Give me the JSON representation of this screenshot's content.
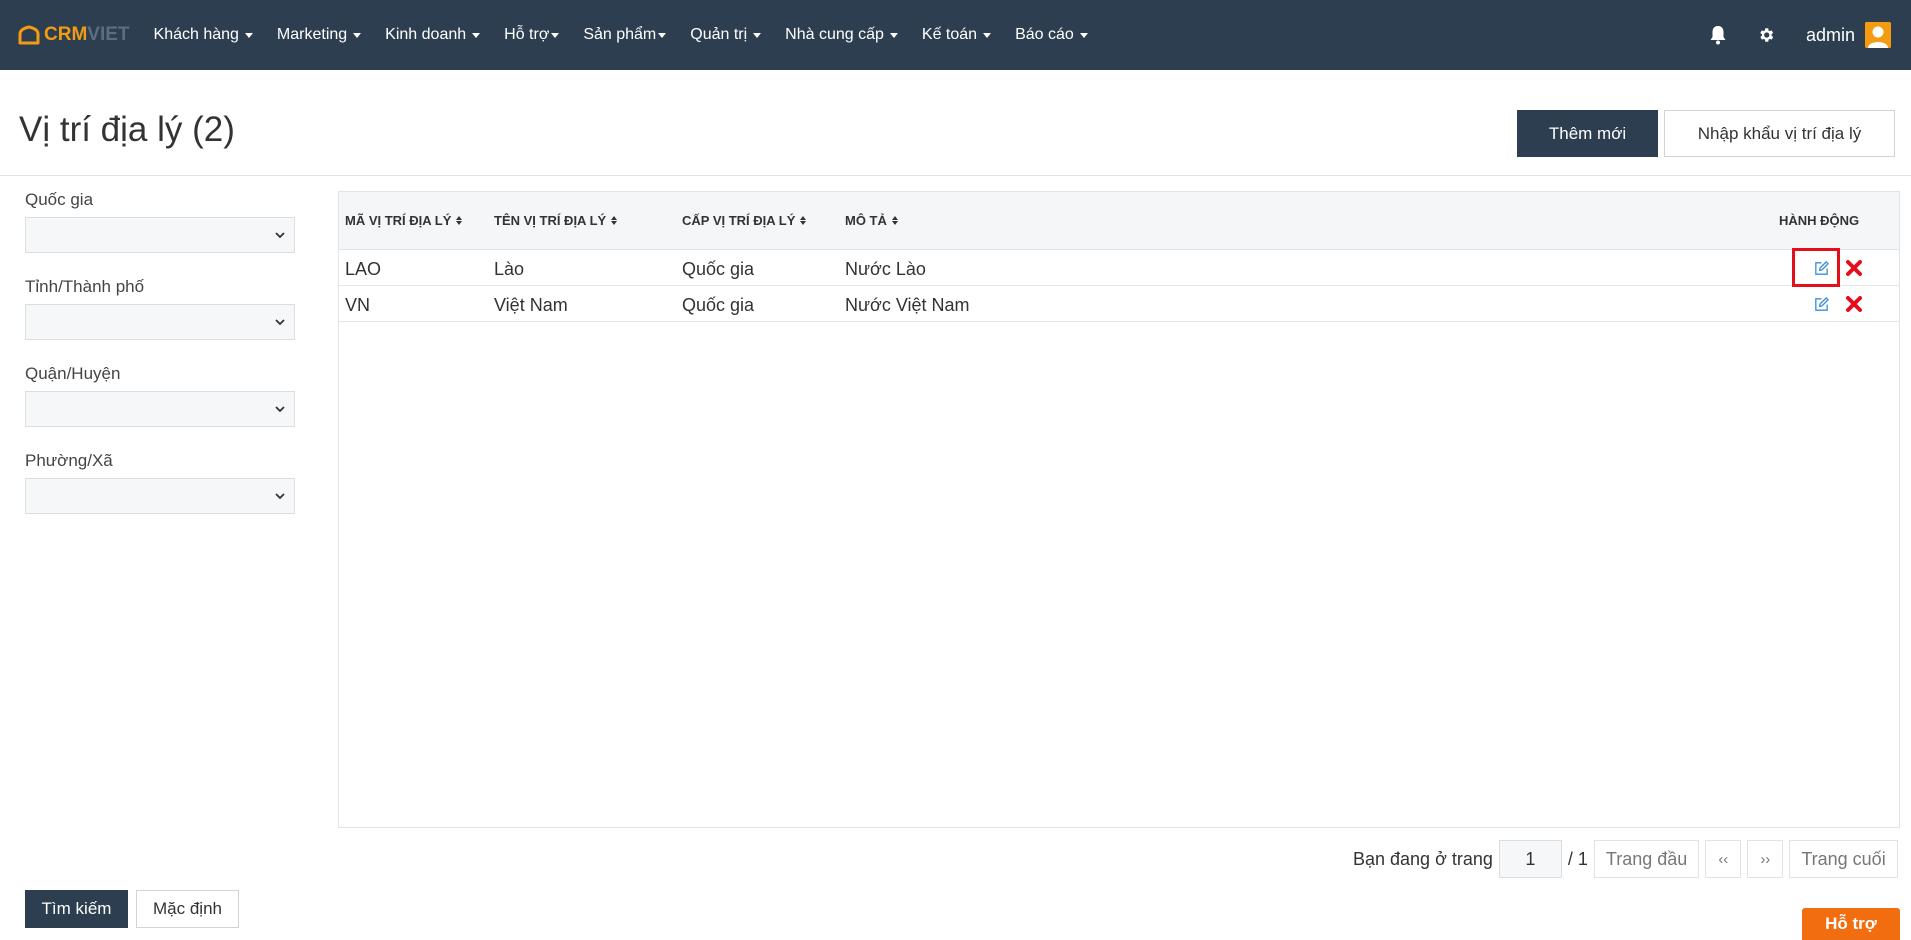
{
  "brand": {
    "crm": "CRM",
    "viet": "VIET"
  },
  "nav": {
    "items": [
      {
        "label": "Khách hàng"
      },
      {
        "label": "Marketing"
      },
      {
        "label": "Kinh doanh"
      },
      {
        "label": "Hỗ trợ"
      },
      {
        "label": "Sản phẩm"
      },
      {
        "label": "Quản trị"
      },
      {
        "label": "Nhà cung cấp"
      },
      {
        "label": "Kế toán"
      },
      {
        "label": "Báo cáo"
      }
    ],
    "user": "admin"
  },
  "page": {
    "title": "Vị trí địa lý (2)",
    "add_label": "Thêm mới",
    "import_label": "Nhập khẩu vị trí địa lý"
  },
  "filters": {
    "country_label": "Quốc gia",
    "province_label": "Tỉnh/Thành phố",
    "district_label": "Quận/Huyện",
    "ward_label": "Phường/Xã",
    "search_label": "Tìm kiếm",
    "default_label": "Mặc định"
  },
  "table": {
    "headers": {
      "code": "MÃ VỊ TRÍ ĐỊA LÝ",
      "name": "TÊN VỊ TRÍ ĐỊA LÝ",
      "level": "CẤP VỊ TRÍ ĐỊA LÝ",
      "desc": "MÔ TẢ",
      "action": "HÀNH ĐỘNG"
    },
    "rows": [
      {
        "code": "LAO",
        "name": "Lào",
        "level": "Quốc gia",
        "desc": "Nước Lào"
      },
      {
        "code": "VN",
        "name": "Việt Nam",
        "level": "Quốc gia",
        "desc": "Nước Việt Nam"
      }
    ]
  },
  "pagination": {
    "prefix": "Bạn đang ở trang",
    "current": "1",
    "total": "/ 1",
    "first": "Trang đầu",
    "prev": "‹‹",
    "next": "››",
    "last": "Trang cuối"
  },
  "support_label": "Hỗ trợ",
  "colors": {
    "nav_bg": "#2c3e50",
    "brand_orange": "#f39c12",
    "delete_red": "#e3101b",
    "edit_blue": "#3b8fd6",
    "support_orange": "#f26c10"
  }
}
